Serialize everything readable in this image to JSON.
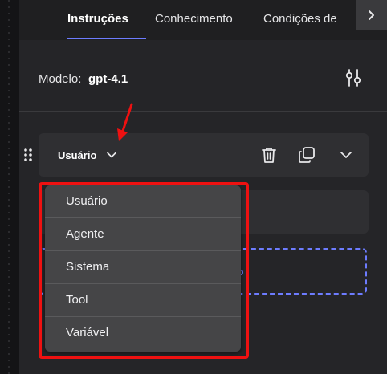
{
  "tabs": [
    {
      "label": "Instruções",
      "active": true
    },
    {
      "label": "Conhecimento",
      "active": false
    },
    {
      "label": "Condições de",
      "active": false
    }
  ],
  "model": {
    "label": "Modelo:",
    "value": "gpt-4.1"
  },
  "message": {
    "role": "Usuário"
  },
  "add_message_label": "ção",
  "dropdown": {
    "options": [
      "Usuário",
      "Agente",
      "Sistema",
      "Tool",
      "Variável"
    ]
  },
  "colors": {
    "accent": "#6d7cff",
    "highlight": "#ee1111",
    "background": "#252528"
  },
  "icons": {
    "tab_scroll": "chevron-right-icon",
    "model_settings": "sliders-icon",
    "drag": "drag-handle-icon",
    "role_chevron": "chevron-down-icon",
    "delete": "trash-icon",
    "duplicate": "copy-icon",
    "collapse": "chevron-down-icon"
  }
}
